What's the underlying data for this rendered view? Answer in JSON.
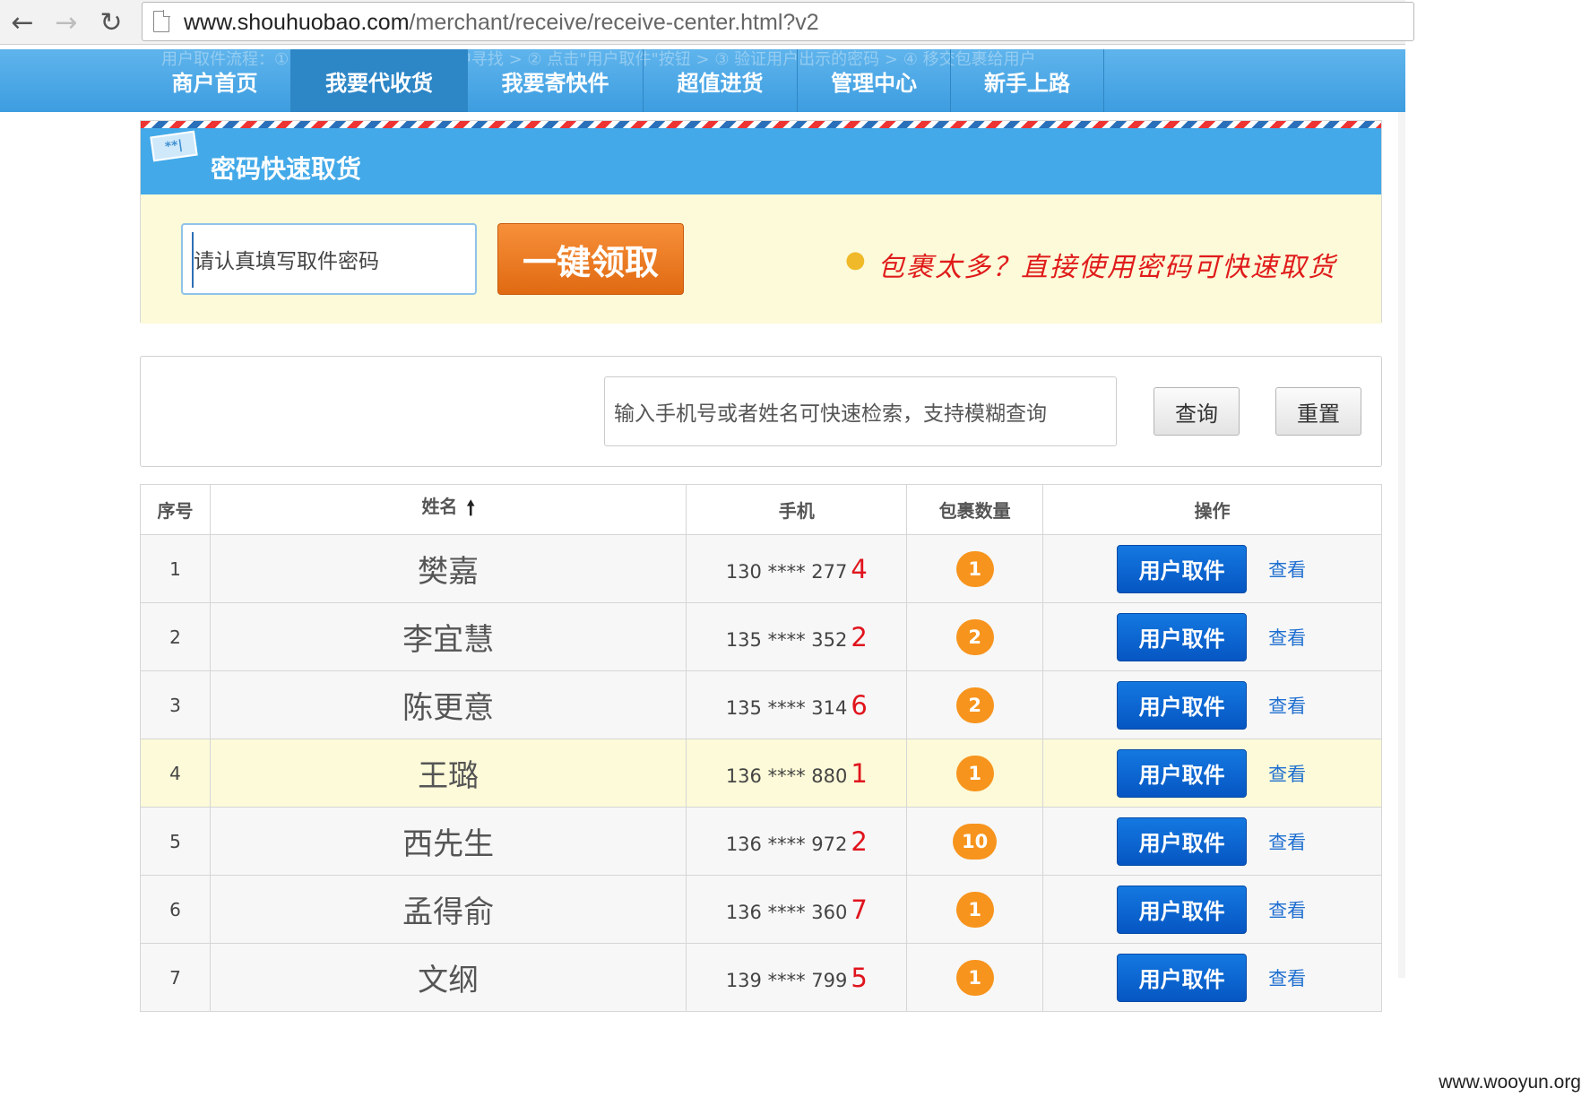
{
  "browser": {
    "url_host": "www.shouhuobao.com",
    "url_path": "/merchant/receive/receive-center.html?v2"
  },
  "site_nav": {
    "hint": "用户取件流程：① 询问用户姓名并在列表中寻找 > ② 点击\"用户取件\"按钮 > ③ 验证用户出示的密码 > ④ 移交包裹给用户",
    "items": [
      {
        "label": "商户首页"
      },
      {
        "label": "我要代收货"
      },
      {
        "label": "我要寄快件"
      },
      {
        "label": "超值进货"
      },
      {
        "label": "管理中心"
      },
      {
        "label": "新手上路"
      }
    ]
  },
  "quick_pickup": {
    "title": "密码快速取货",
    "password_placeholder": "请认真填写取件密码",
    "button_label": "一键领取",
    "tip": "包裹太多？直接使用密码可快速取货"
  },
  "search": {
    "placeholder": "输入手机号或者姓名可快速检索，支持模糊查询",
    "query_label": "查询",
    "reset_label": "重置"
  },
  "table": {
    "headers": {
      "index": "序号",
      "name": "姓名",
      "phone": "手机",
      "count": "包裹数量",
      "ops": "操作"
    },
    "rows": [
      {
        "index": "1",
        "name": "樊嘉",
        "phone": "130 **** 277",
        "phone_last": "4",
        "count": "1",
        "pick": "用户取件",
        "view": "查看"
      },
      {
        "index": "2",
        "name": "李宜慧",
        "phone": "135 **** 352",
        "phone_last": "2",
        "count": "2",
        "pick": "用户取件",
        "view": "查看"
      },
      {
        "index": "3",
        "name": "陈更意",
        "phone": "135 **** 314",
        "phone_last": "6",
        "count": "2",
        "pick": "用户取件",
        "view": "查看"
      },
      {
        "index": "4",
        "name": "王璐",
        "phone": "136 **** 880",
        "phone_last": "1",
        "count": "1",
        "pick": "用户取件",
        "view": "查看"
      },
      {
        "index": "5",
        "name": "西先生",
        "phone": "136 **** 972",
        "phone_last": "2",
        "count": "10",
        "pick": "用户取件",
        "view": "查看"
      },
      {
        "index": "6",
        "name": "孟得俞",
        "phone": "136 **** 360",
        "phone_last": "7",
        "count": "1",
        "pick": "用户取件",
        "view": "查看"
      },
      {
        "index": "7",
        "name": "文纲",
        "phone": "139 **** 799",
        "phone_last": "5",
        "count": "1",
        "pick": "用户取件",
        "view": "查看"
      }
    ]
  },
  "watermark": "www.wooyun.org",
  "colors": {
    "nav_blue": "#43a9e8",
    "orange_button": "#f7903a",
    "pick_button_blue": "#0656c3",
    "badge_orange": "#f7941d",
    "highlight_red": "#e0141d",
    "panel_yellow": "#fcfad8"
  }
}
